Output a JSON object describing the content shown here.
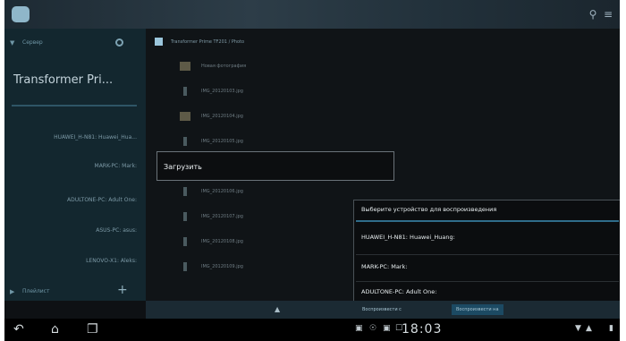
{
  "left_panel": {
    "header": "Сервер",
    "title": "Transformer Pri...",
    "devices": [
      "HUAWEI_H-N81: Huawei_Hua...",
      "MARK-PC: Mark:",
      "ADULTONE-PC: Adult One:",
      "ASUS-PC: asus:",
      "LENOVO-X1: Aleks:"
    ],
    "footer": "Плейлист"
  },
  "file_list": {
    "path": "Transformer Prime TF201 / Photo",
    "items": [
      "Новая фотография",
      "IMG_20120103.jpg",
      "IMG_20120104.jpg",
      "IMG_20120105.jpg",
      "IMG_20120106.jpg",
      "IMG_20120107.jpg",
      "IMG_20120108.jpg",
      "IMG_20120109.jpg"
    ]
  },
  "upload_dialog": {
    "label": "Загрузить"
  },
  "device_dialog": {
    "title": "Выберите устройство для воспроизведения",
    "items": [
      "HUAWEI_H-N81: Huawei_Huang:",
      "MARK-PC: Mark:",
      "ADULTONE-PC: Adult One:"
    ]
  },
  "bottom_bar": {
    "play_to": "Воспроизвести с",
    "play_on": "Воспроизвести на"
  },
  "status_bar": {
    "time": "18:03"
  },
  "colors": {
    "accent": "#2f6c8a",
    "panel": "#13272f"
  }
}
